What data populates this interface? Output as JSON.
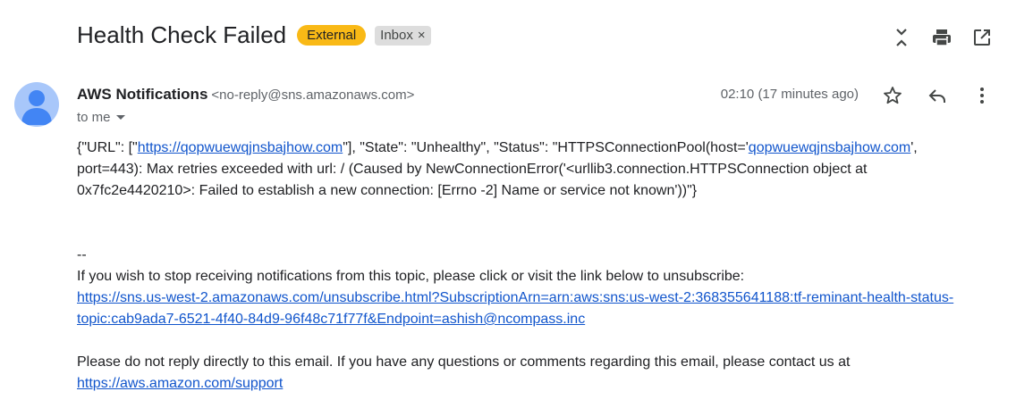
{
  "subject": "Health Check Failed",
  "labels": {
    "external": "External",
    "inbox": "Inbox",
    "inbox_remove": "×"
  },
  "sender": {
    "name": "AWS Notifications",
    "email": "<no-reply@sns.amazonaws.com>",
    "to": "to me",
    "time": "02:10 (17 minutes ago)"
  },
  "body": {
    "l1_a": "{\"URL\": [\"",
    "l1_link": "https://qopwuewqjnsbajhow.com",
    "l1_b": "\"], \"State\": \"Unhealthy\", \"Status\": \"HTTPSConnectionPool(host='",
    "l1_link2": "qopwuewqjnsbajhow.com",
    "l1_c": "', port=443): Max retries exceeded with url: / (Caused by NewConnectionError('<urllib3.connection.HTTPSConnection object at 0x7fc2e4420210>: Failed to establish a new connection: [Errno -2] Name or service not known'))\"}",
    "sig": "--",
    "unsub_text": "If you wish to stop receiving notifications from this topic, please click or visit the link below to unsubscribe:",
    "unsub_link": "https://sns.us-west-2.amazonaws.com/unsubscribe.html?SubscriptionArn=arn:aws:sns:us-west-2:368355641188:tf-reminant-health-status-topic:cab9ada7-6521-4f40-84d9-96f48c71f77f&Endpoint=ashish@ncompass.inc",
    "reply_text": "Please do not reply directly to this email. If you have any questions or comments regarding this email, please contact us at",
    "support_link": "https://aws.amazon.com/support"
  },
  "colors": {
    "accent_link": "#1155cc",
    "external_badge": "#f9b916",
    "avatar": "#a8c7fa",
    "avatar_fg": "#4285f4"
  },
  "icons": [
    "expand-collapse-icon",
    "print-icon",
    "open-in-new-icon",
    "star-icon",
    "reply-icon",
    "more-vert-icon",
    "avatar-person-icon",
    "caret-down-icon"
  ]
}
